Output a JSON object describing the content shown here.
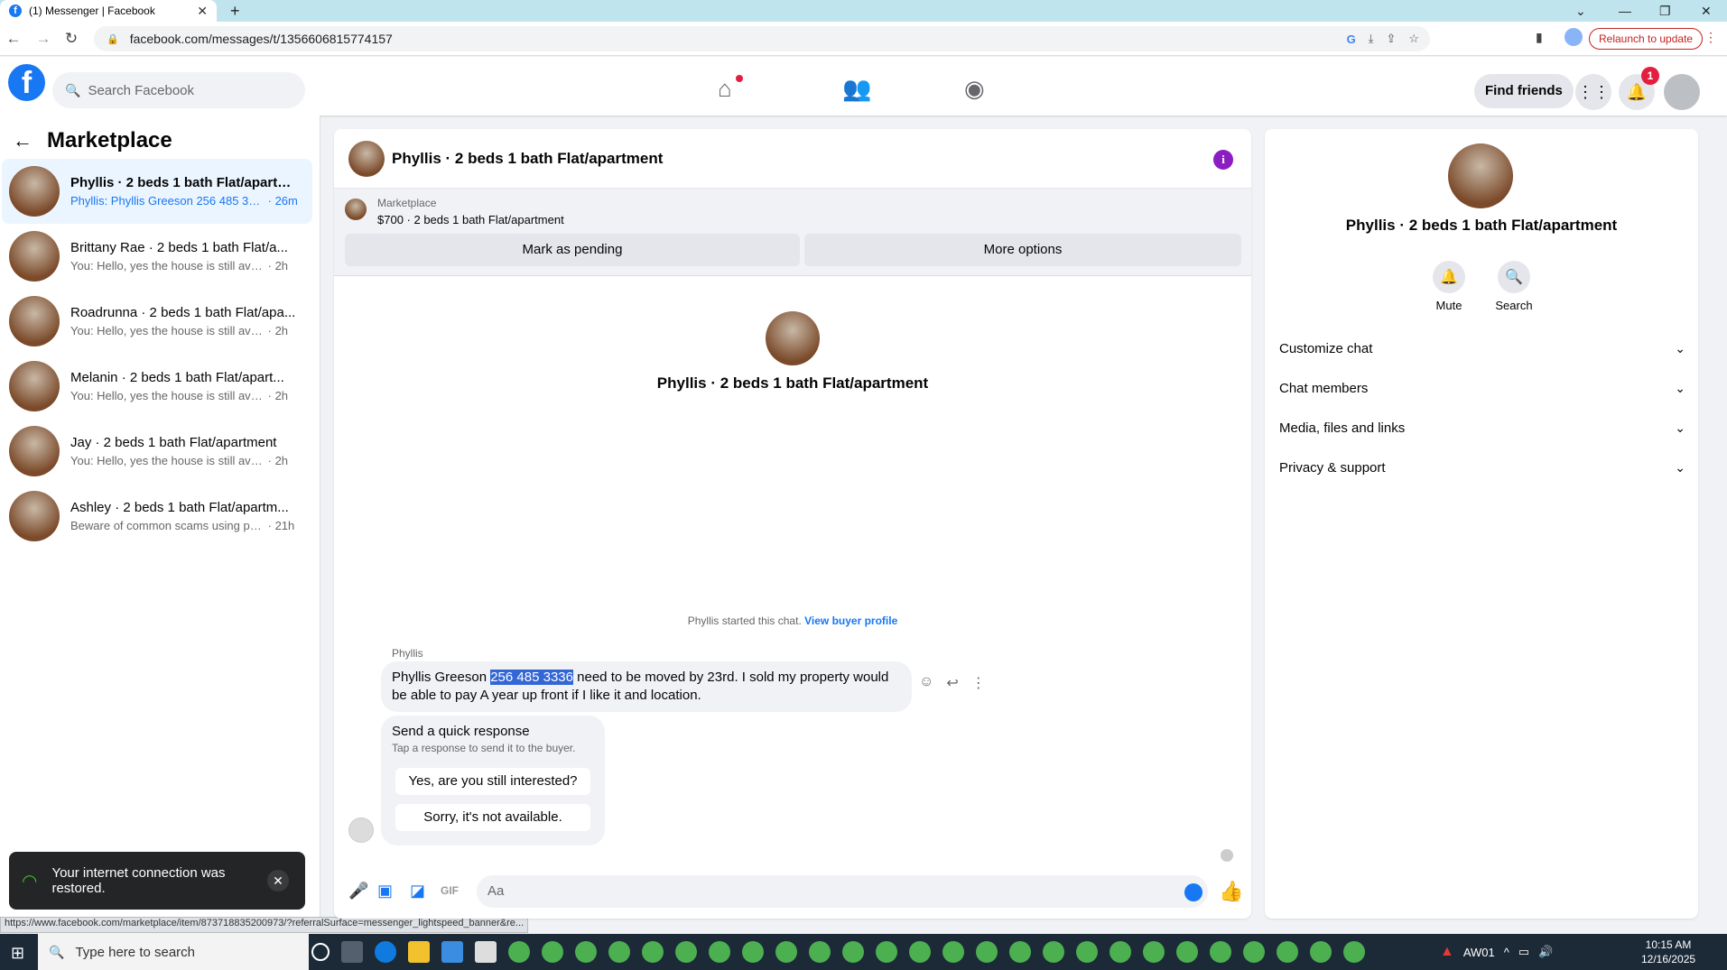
{
  "browser": {
    "tab_title": "(1) Messenger | Facebook",
    "url": "facebook.com/messages/t/1356606815774157",
    "relaunch_label": "Relaunch to update"
  },
  "header": {
    "search_placeholder": "Search Facebook",
    "find_friends": "Find friends",
    "notification_count": "1"
  },
  "sidebar": {
    "title": "Marketplace",
    "conversations": [
      {
        "title": "Phyllis · 2 beds 1 bath Flat/apartm...",
        "preview": "Phyllis: Phyllis Greeson 256 485 333...",
        "time": "26m"
      },
      {
        "title": "Brittany Rae · 2 beds 1 bath Flat/a...",
        "preview": "You: Hello, yes the house is still availa...",
        "time": "2h"
      },
      {
        "title": "Roadrunna · 2 beds 1 bath Flat/apa...",
        "preview": "You: Hello, yes the house is still availa...",
        "time": "2h"
      },
      {
        "title": "Melanin · 2 beds 1 bath Flat/apart...",
        "preview": "You: Hello, yes the house is still availa...",
        "time": "2h"
      },
      {
        "title": "Jay · 2 beds 1 bath Flat/apartment",
        "preview": "You: Hello, yes the house is still availa...",
        "time": "2h"
      },
      {
        "title": "Ashley · 2 beds 1 bath Flat/apartm...",
        "preview": "Beware of common scams using pay...",
        "time": "21h"
      }
    ]
  },
  "toast": {
    "message": "Your internet connection was restored."
  },
  "status_url": "https://www.facebook.com/marketplace/item/873718835200973/?referralSurface=messenger_lightspeed_banner&re...",
  "chat": {
    "title": "Phyllis · 2 beds 1 bath Flat/apartment",
    "listing_label": "Marketplace",
    "listing_detail": "$700 · 2 beds 1 bath Flat/apartment",
    "mark_pending": "Mark as pending",
    "more_options": "More options",
    "center_title": "Phyllis · 2 beds 1 bath Flat/apartment",
    "started_text": "Phyllis started this chat.",
    "view_profile": "View buyer profile",
    "sender": "Phyllis",
    "message_pre": "Phyllis Greeson ",
    "message_highlight": "256 485 3336",
    "message_post": " need to be moved by 23rd. I sold my property would be able to pay A year up front if I like it and location.",
    "quick_title": "Send a quick response",
    "quick_sub": "Tap a response to send it to the buyer.",
    "quick_1": "Yes, are you still interested?",
    "quick_2": "Sorry, it's not available.",
    "input_placeholder": "Aa"
  },
  "right_panel": {
    "title": "Phyllis · 2 beds 1 bath Flat/apartment",
    "mute": "Mute",
    "search": "Search",
    "sections": [
      "Customize chat",
      "Chat members",
      "Media, files and links",
      "Privacy & support"
    ]
  },
  "taskbar": {
    "search_placeholder": "Type here to search",
    "tray_label": "AW01",
    "time": "10:15 AM",
    "date": "12/16/2025"
  }
}
